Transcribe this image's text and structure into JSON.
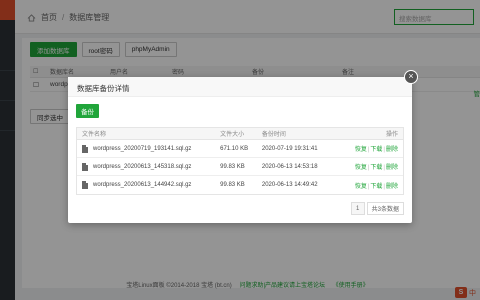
{
  "breadcrumb": {
    "home": "首页",
    "separator": "/",
    "current": "数据库管理"
  },
  "search": {
    "placeholder": "搜索数据库"
  },
  "toolbar": {
    "add": "添加数据库",
    "root": "root密码",
    "phpmyadmin": "phpMyAdmin"
  },
  "db_table": {
    "headers": [
      "数据库名",
      "用户名",
      "密码",
      "备份",
      "备注"
    ],
    "row_name": "wordp",
    "manage": "管"
  },
  "sync_button": "同步选中",
  "footer": {
    "text": "宝塔Linux面板 ©2014-2018 宝塔 (bt.cn)",
    "link1": "问题求助|产品建议请上宝塔论坛",
    "link2": "《使用手册》"
  },
  "ime": {
    "logo": "S",
    "lang": "中"
  },
  "modal": {
    "title": "数据库备份详情",
    "close": "×",
    "backup_button": "备份",
    "headers": {
      "name": "文件名称",
      "size": "文件大小",
      "time": "备份时间",
      "ops": "操作"
    },
    "rows": [
      {
        "name": "wordpress_20200719_193141.sql.gz",
        "size": "671.10 KB",
        "time": "2020-07-19 19:31:41"
      },
      {
        "name": "wordpress_20200613_145318.sql.gz",
        "size": "99.83 KB",
        "time": "2020-06-13 14:53:18"
      },
      {
        "name": "wordpress_20200613_144942.sql.gz",
        "size": "99.83 KB",
        "time": "2020-06-13 14:49:42"
      }
    ],
    "ops": {
      "restore": "恢复",
      "download": "下载",
      "delete": "删除",
      "sep": "|"
    },
    "pager": {
      "page": "1",
      "total": "共3条数据"
    }
  },
  "colors": {
    "accent": "#20a53a",
    "sidebar": "#2b3136",
    "logo": "#e0502c"
  }
}
